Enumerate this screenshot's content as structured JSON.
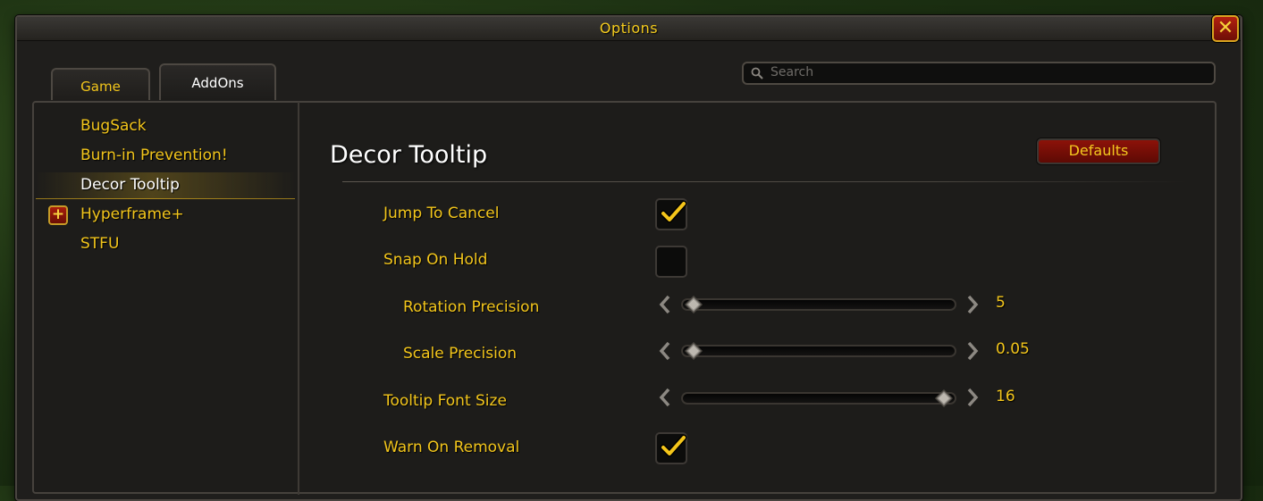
{
  "window": {
    "title": "Options",
    "close_label": "✕"
  },
  "tabs": [
    {
      "label": "Game",
      "active": false
    },
    {
      "label": "AddOns",
      "active": true
    }
  ],
  "search": {
    "placeholder": "Search"
  },
  "sidebar": {
    "items": [
      {
        "label": "BugSack"
      },
      {
        "label": "Burn-in Prevention!"
      },
      {
        "label": "Decor Tooltip",
        "selected": true
      },
      {
        "label": "Hyperframe+",
        "expandable": true
      },
      {
        "label": "STFU"
      }
    ],
    "expand_symbol": "+"
  },
  "panel": {
    "title": "Decor Tooltip",
    "defaults_label": "Defaults",
    "options": {
      "jump_to_cancel": {
        "label": "Jump To Cancel",
        "checked": true
      },
      "snap_on_hold": {
        "label": "Snap On Hold",
        "checked": false
      },
      "rotation_precision": {
        "label": "Rotation Precision",
        "value": "5",
        "fraction": 0.0
      },
      "scale_precision": {
        "label": "Scale Precision",
        "value": "0.05",
        "fraction": 0.0
      },
      "tooltip_font_size": {
        "label": "Tooltip Font Size",
        "value": "16",
        "fraction": 1.0
      },
      "warn_on_removal": {
        "label": "Warn On Removal",
        "checked": true
      }
    }
  },
  "colors": {
    "gold_text": "#f2c51b",
    "white_text": "#ffffff",
    "button_red": "#8c1209",
    "frame_bg": "#1f1e1c"
  },
  "icons": {
    "search": "search-icon",
    "close": "close-icon",
    "check": "checkmark-icon",
    "arrow_left": "arrow-left-icon",
    "arrow_right": "arrow-right-icon",
    "thumb": "slider-thumb-icon",
    "expand": "plus-icon"
  }
}
